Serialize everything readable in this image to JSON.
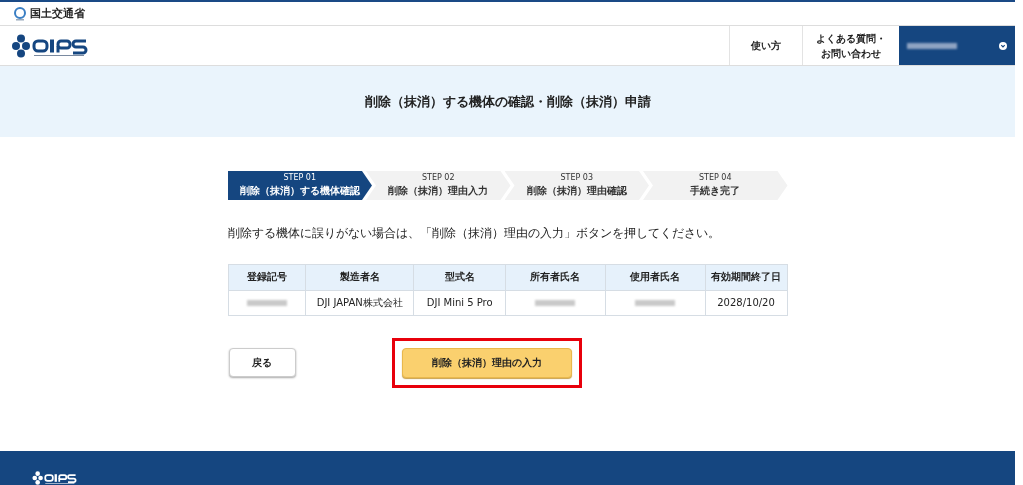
{
  "gov_bar": {
    "ministry": "国土交通省"
  },
  "header": {
    "nav": [
      {
        "lines": [
          "使い方"
        ]
      },
      {
        "lines": [
          "よくある質問・",
          "お問い合わせ"
        ]
      }
    ],
    "user": {
      "blurred": true
    }
  },
  "banner": {
    "title": "削除（抹消）する機体の確認・削除（抹消）申請"
  },
  "steps": [
    {
      "step": "STEP 01",
      "label": "削除（抹消）する機体確認",
      "selected": true
    },
    {
      "step": "STEP 02",
      "label": "削除（抹消）理由入力",
      "selected": false
    },
    {
      "step": "STEP 03",
      "label": "削除（抹消）理由確認",
      "selected": false
    },
    {
      "step": "STEP 04",
      "label": "手続き完了",
      "selected": false
    }
  ],
  "instruction": "削除する機体に誤りがない場合は、「削除（抹消）理由の入力」ボタンを押してください。",
  "table": {
    "columns": [
      "登録記号",
      "製造者名",
      "型式名",
      "所有者氏名",
      "使用者氏名",
      "有効期間終了日"
    ],
    "rows": [
      [
        {
          "blurred": true
        },
        {
          "text": "DJI JAPAN株式会社"
        },
        {
          "text": "DJI Mini 5 Pro"
        },
        {
          "blurred": true
        },
        {
          "blurred": true
        },
        {
          "text": "2028/10/20"
        }
      ]
    ]
  },
  "buttons": [
    {
      "kind": "secondary",
      "label": "戻る",
      "highlighted": false
    },
    {
      "kind": "primary",
      "label": "削除（抹消）理由の入力",
      "highlighted": true
    }
  ]
}
